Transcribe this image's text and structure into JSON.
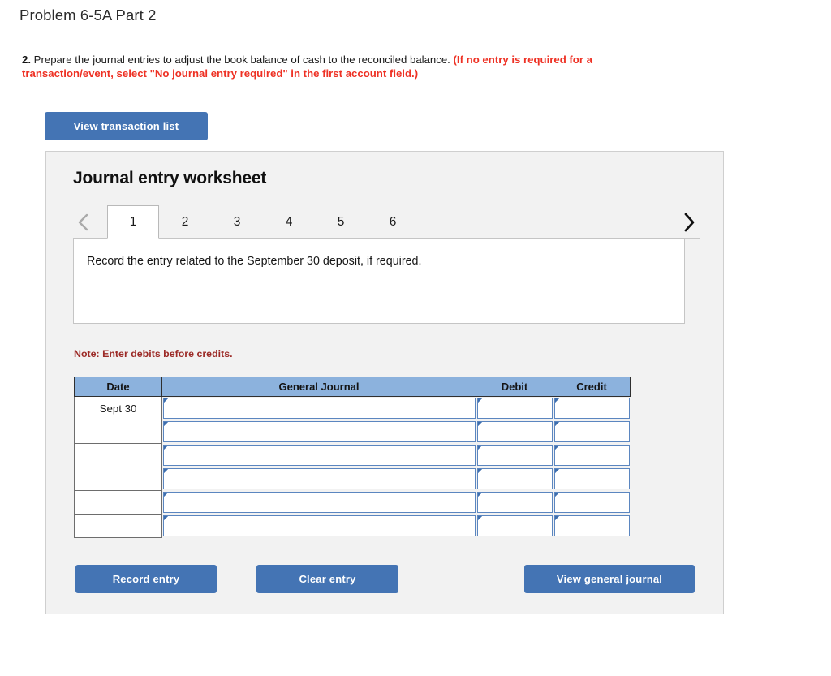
{
  "page_title": "Problem 6-5A Part 2",
  "question": {
    "number": "2.",
    "text": "Prepare the journal entries to adjust the book balance of cash to the reconciled balance.",
    "red_text": "(If no entry is required for a transaction/event, select \"No journal entry required\" in the first account field.)"
  },
  "toolbar": {
    "view_transaction_list_label": "View transaction list"
  },
  "worksheet": {
    "title": "Journal entry worksheet",
    "prev_icon": "chevron-left-icon",
    "next_icon": "chevron-right-icon",
    "tabs": [
      {
        "label": "1",
        "active": true
      },
      {
        "label": "2",
        "active": false
      },
      {
        "label": "3",
        "active": false
      },
      {
        "label": "4",
        "active": false
      },
      {
        "label": "5",
        "active": false
      },
      {
        "label": "6",
        "active": false
      }
    ],
    "prompt": "Record the entry related to the September 30 deposit, if required.",
    "note": "Note: Enter debits before credits."
  },
  "table": {
    "headers": [
      "Date",
      "General Journal",
      "Debit",
      "Credit"
    ],
    "rows": [
      {
        "date": "Sept 30",
        "general_journal": "",
        "debit": "",
        "credit": ""
      },
      {
        "date": "",
        "general_journal": "",
        "debit": "",
        "credit": ""
      },
      {
        "date": "",
        "general_journal": "",
        "debit": "",
        "credit": ""
      },
      {
        "date": "",
        "general_journal": "",
        "debit": "",
        "credit": ""
      },
      {
        "date": "",
        "general_journal": "",
        "debit": "",
        "credit": ""
      },
      {
        "date": "",
        "general_journal": "",
        "debit": "",
        "credit": ""
      }
    ]
  },
  "actions": {
    "record_entry_label": "Record entry",
    "clear_entry_label": "Clear entry",
    "view_general_journal_label": "View general journal"
  },
  "colors": {
    "button_blue": "#4474b4",
    "header_blue": "#8cb2dd",
    "red_instruction": "#ee3124",
    "note_red": "#9c2a26",
    "panel_bg": "#f2f2f2",
    "input_border_blue": "#5b86c0"
  }
}
